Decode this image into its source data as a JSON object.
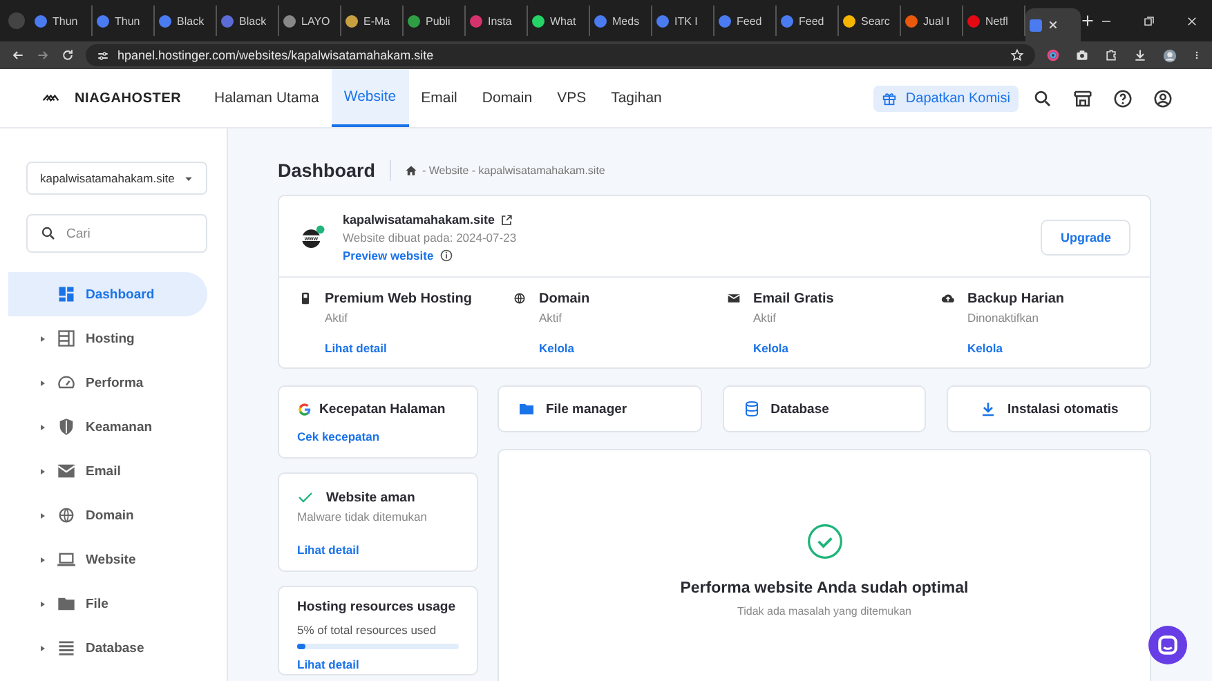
{
  "browser": {
    "tabs": [
      {
        "title": "Thun",
        "selected": false
      },
      {
        "title": "Thun",
        "selected": false
      },
      {
        "title": "Black",
        "selected": false
      },
      {
        "title": "Black",
        "selected": false
      },
      {
        "title": "LAYO",
        "selected": false
      },
      {
        "title": "E-Ma",
        "selected": false
      },
      {
        "title": "Publi",
        "selected": false
      },
      {
        "title": "Insta",
        "selected": false
      },
      {
        "title": "What",
        "selected": false
      },
      {
        "title": "Meds",
        "selected": false
      },
      {
        "title": "ITK I",
        "selected": false
      },
      {
        "title": "Feed",
        "selected": false
      },
      {
        "title": "Feed",
        "selected": false
      },
      {
        "title": "Searc",
        "selected": false
      },
      {
        "title": "Jual I",
        "selected": false
      },
      {
        "title": "Netfl",
        "selected": false
      },
      {
        "selected": true
      }
    ],
    "url": "hpanel.hostinger.com/websites/kapalwisatamahakam.site"
  },
  "header": {
    "brand": "NIAGAHOSTER",
    "nav": [
      {
        "label": "Halaman Utama",
        "selected": false
      },
      {
        "label": "Website",
        "selected": true
      },
      {
        "label": "Email",
        "selected": false
      },
      {
        "label": "Domain",
        "selected": false
      },
      {
        "label": "VPS",
        "selected": false
      },
      {
        "label": "Tagihan",
        "selected": false
      }
    ],
    "promo": "Dapatkan Komisi"
  },
  "sidebar": {
    "site_select": "kapalwisatamahakam.site",
    "search": {
      "placeholder": "Cari"
    },
    "items": [
      {
        "label": "Dashboard",
        "selected": true,
        "expandable": false
      },
      {
        "label": "Hosting",
        "selected": false,
        "expandable": true
      },
      {
        "label": "Performa",
        "selected": false,
        "expandable": true
      },
      {
        "label": "Keamanan",
        "selected": false,
        "expandable": true
      },
      {
        "label": "Email",
        "selected": false,
        "expandable": true
      },
      {
        "label": "Domain",
        "selected": false,
        "expandable": true
      },
      {
        "label": "Website",
        "selected": false,
        "expandable": true
      },
      {
        "label": "File",
        "selected": false,
        "expandable": true
      },
      {
        "label": "Database",
        "selected": false,
        "expandable": true
      }
    ]
  },
  "main": {
    "title": "Dashboard",
    "breadcrumb": "- Website - kapalwisatamahakam.site",
    "site": {
      "icon_label": "www",
      "name": "kapalwisatamahakam.site",
      "created": "Website dibuat pada: 2024-07-23",
      "preview": "Preview website",
      "online": true,
      "upgrade": "Upgrade"
    },
    "services": [
      {
        "name": "Premium Web Hosting",
        "status": "Aktif",
        "action": "Lihat detail"
      },
      {
        "name": "Domain",
        "status": "Aktif",
        "action": "Kelola"
      },
      {
        "name": "Email Gratis",
        "status": "Aktif",
        "action": "Kelola"
      },
      {
        "name": "Backup Harian",
        "status": "Dinonaktifkan",
        "action": "Kelola"
      }
    ],
    "speed": {
      "title": "Kecepatan Halaman",
      "action": "Cek kecepatan"
    },
    "security": {
      "title": "Website aman",
      "status": "Malware tidak ditemukan",
      "action": "Lihat detail"
    },
    "resources": {
      "title": "Hosting resources usage",
      "usage": "5% of total resources used",
      "level": 0.05,
      "action": "Lihat detail"
    },
    "shortcuts": [
      "File manager",
      "Database",
      "Instalasi otomatis"
    ],
    "performance": {
      "title": "Performa website Anda sudah optimal",
      "subtitle": "Tidak ada masalah yang ditemukan"
    }
  }
}
